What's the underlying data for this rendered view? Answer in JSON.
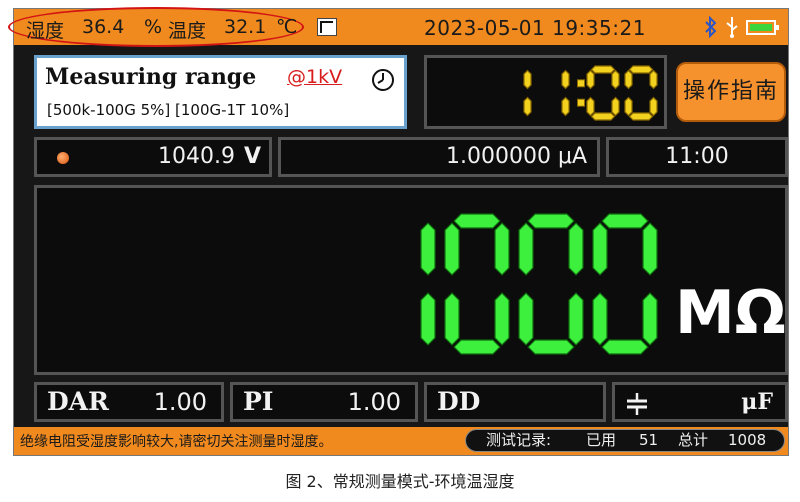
{
  "status_bar": {
    "humidity_label": "湿度",
    "humidity_value": "36.4",
    "humidity_unit": "%",
    "temperature_label": "温度",
    "temperature_value": "32.1",
    "temperature_unit": "℃",
    "datetime": "2023-05-01 19:35:21",
    "icons": [
      "pulse-mode-icon",
      "bluetooth-icon",
      "usb-icon",
      "battery-icon"
    ],
    "battery_level": 0.8,
    "highlight_color": "#d21414"
  },
  "range_panel": {
    "title": "Measuring range",
    "test_voltage": "@1kV",
    "spec": "[500k-100G  5%]   [100G-1T  10%]",
    "icon": "clock-icon"
  },
  "timer": {
    "display": "11:00",
    "color": "#f2d21e"
  },
  "guide_button": {
    "label": "操作指南"
  },
  "readouts": {
    "voltage": "1040.9",
    "voltage_unit": "V",
    "current": "1.000000 μA",
    "elapsed": "11:00",
    "led_color": "#e0621a"
  },
  "main_display": {
    "value": "1000",
    "unit": "MΩ",
    "digit_color": "#3ef03e"
  },
  "bottom_row": {
    "dar_label": "DAR",
    "dar_value": "1.00",
    "pi_label": "PI",
    "pi_value": "1.00",
    "dd_label": "DD",
    "dd_value": "",
    "cap_unit": "μF",
    "cap_icon": "capacitor-icon"
  },
  "bottom_bar": {
    "warning": "绝缘电阻受湿度影响较大,请密切关注测量时湿度。",
    "record_label": "测试记录:",
    "used_label": "已用",
    "used_value": "51",
    "total_label": "总计",
    "total_value": "1008"
  },
  "caption": "图 2、常规测量模式-环境温湿度",
  "colors": {
    "accent_orange": "#f08a1e",
    "panel_border": "#555555",
    "range_border": "#6aa0cc",
    "background": "#171717"
  }
}
